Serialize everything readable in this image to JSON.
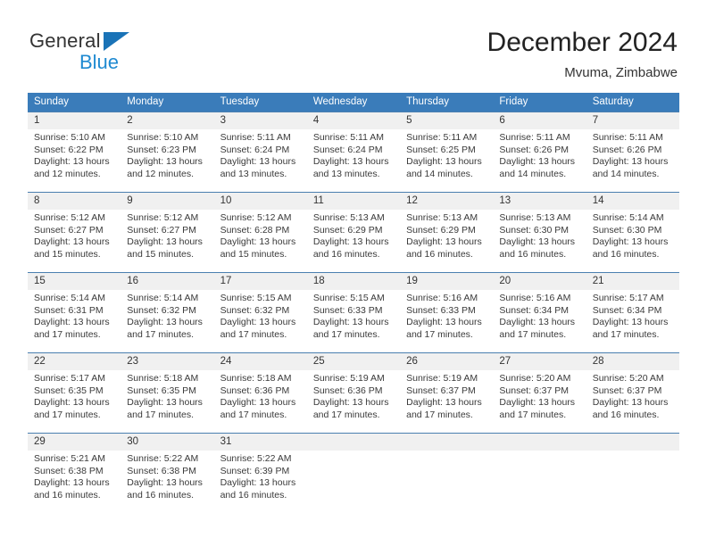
{
  "brand": {
    "name_top": "General",
    "name_bottom": "Blue",
    "triangle_color": "#1a73b7",
    "blue_text_color": "#1f8ad1"
  },
  "header": {
    "title": "December 2024",
    "subtitle": "Mvuma, Zimbabwe"
  },
  "theme": {
    "header_row_bg": "#3a7cba",
    "header_row_text": "#ffffff",
    "daynum_bg": "#f0f0f0",
    "cell_bg": "#ffffff",
    "row_divider": "#4a7fb0"
  },
  "weekdays": [
    "Sunday",
    "Monday",
    "Tuesday",
    "Wednesday",
    "Thursday",
    "Friday",
    "Saturday"
  ],
  "weeks": [
    {
      "days": [
        {
          "num": "1",
          "sunrise": "Sunrise: 5:10 AM",
          "sunset": "Sunset: 6:22 PM",
          "daylight1": "Daylight: 13 hours",
          "daylight2": "and 12 minutes."
        },
        {
          "num": "2",
          "sunrise": "Sunrise: 5:10 AM",
          "sunset": "Sunset: 6:23 PM",
          "daylight1": "Daylight: 13 hours",
          "daylight2": "and 12 minutes."
        },
        {
          "num": "3",
          "sunrise": "Sunrise: 5:11 AM",
          "sunset": "Sunset: 6:24 PM",
          "daylight1": "Daylight: 13 hours",
          "daylight2": "and 13 minutes."
        },
        {
          "num": "4",
          "sunrise": "Sunrise: 5:11 AM",
          "sunset": "Sunset: 6:24 PM",
          "daylight1": "Daylight: 13 hours",
          "daylight2": "and 13 minutes."
        },
        {
          "num": "5",
          "sunrise": "Sunrise: 5:11 AM",
          "sunset": "Sunset: 6:25 PM",
          "daylight1": "Daylight: 13 hours",
          "daylight2": "and 14 minutes."
        },
        {
          "num": "6",
          "sunrise": "Sunrise: 5:11 AM",
          "sunset": "Sunset: 6:26 PM",
          "daylight1": "Daylight: 13 hours",
          "daylight2": "and 14 minutes."
        },
        {
          "num": "7",
          "sunrise": "Sunrise: 5:11 AM",
          "sunset": "Sunset: 6:26 PM",
          "daylight1": "Daylight: 13 hours",
          "daylight2": "and 14 minutes."
        }
      ]
    },
    {
      "days": [
        {
          "num": "8",
          "sunrise": "Sunrise: 5:12 AM",
          "sunset": "Sunset: 6:27 PM",
          "daylight1": "Daylight: 13 hours",
          "daylight2": "and 15 minutes."
        },
        {
          "num": "9",
          "sunrise": "Sunrise: 5:12 AM",
          "sunset": "Sunset: 6:27 PM",
          "daylight1": "Daylight: 13 hours",
          "daylight2": "and 15 minutes."
        },
        {
          "num": "10",
          "sunrise": "Sunrise: 5:12 AM",
          "sunset": "Sunset: 6:28 PM",
          "daylight1": "Daylight: 13 hours",
          "daylight2": "and 15 minutes."
        },
        {
          "num": "11",
          "sunrise": "Sunrise: 5:13 AM",
          "sunset": "Sunset: 6:29 PM",
          "daylight1": "Daylight: 13 hours",
          "daylight2": "and 16 minutes."
        },
        {
          "num": "12",
          "sunrise": "Sunrise: 5:13 AM",
          "sunset": "Sunset: 6:29 PM",
          "daylight1": "Daylight: 13 hours",
          "daylight2": "and 16 minutes."
        },
        {
          "num": "13",
          "sunrise": "Sunrise: 5:13 AM",
          "sunset": "Sunset: 6:30 PM",
          "daylight1": "Daylight: 13 hours",
          "daylight2": "and 16 minutes."
        },
        {
          "num": "14",
          "sunrise": "Sunrise: 5:14 AM",
          "sunset": "Sunset: 6:30 PM",
          "daylight1": "Daylight: 13 hours",
          "daylight2": "and 16 minutes."
        }
      ]
    },
    {
      "days": [
        {
          "num": "15",
          "sunrise": "Sunrise: 5:14 AM",
          "sunset": "Sunset: 6:31 PM",
          "daylight1": "Daylight: 13 hours",
          "daylight2": "and 17 minutes."
        },
        {
          "num": "16",
          "sunrise": "Sunrise: 5:14 AM",
          "sunset": "Sunset: 6:32 PM",
          "daylight1": "Daylight: 13 hours",
          "daylight2": "and 17 minutes."
        },
        {
          "num": "17",
          "sunrise": "Sunrise: 5:15 AM",
          "sunset": "Sunset: 6:32 PM",
          "daylight1": "Daylight: 13 hours",
          "daylight2": "and 17 minutes."
        },
        {
          "num": "18",
          "sunrise": "Sunrise: 5:15 AM",
          "sunset": "Sunset: 6:33 PM",
          "daylight1": "Daylight: 13 hours",
          "daylight2": "and 17 minutes."
        },
        {
          "num": "19",
          "sunrise": "Sunrise: 5:16 AM",
          "sunset": "Sunset: 6:33 PM",
          "daylight1": "Daylight: 13 hours",
          "daylight2": "and 17 minutes."
        },
        {
          "num": "20",
          "sunrise": "Sunrise: 5:16 AM",
          "sunset": "Sunset: 6:34 PM",
          "daylight1": "Daylight: 13 hours",
          "daylight2": "and 17 minutes."
        },
        {
          "num": "21",
          "sunrise": "Sunrise: 5:17 AM",
          "sunset": "Sunset: 6:34 PM",
          "daylight1": "Daylight: 13 hours",
          "daylight2": "and 17 minutes."
        }
      ]
    },
    {
      "days": [
        {
          "num": "22",
          "sunrise": "Sunrise: 5:17 AM",
          "sunset": "Sunset: 6:35 PM",
          "daylight1": "Daylight: 13 hours",
          "daylight2": "and 17 minutes."
        },
        {
          "num": "23",
          "sunrise": "Sunrise: 5:18 AM",
          "sunset": "Sunset: 6:35 PM",
          "daylight1": "Daylight: 13 hours",
          "daylight2": "and 17 minutes."
        },
        {
          "num": "24",
          "sunrise": "Sunrise: 5:18 AM",
          "sunset": "Sunset: 6:36 PM",
          "daylight1": "Daylight: 13 hours",
          "daylight2": "and 17 minutes."
        },
        {
          "num": "25",
          "sunrise": "Sunrise: 5:19 AM",
          "sunset": "Sunset: 6:36 PM",
          "daylight1": "Daylight: 13 hours",
          "daylight2": "and 17 minutes."
        },
        {
          "num": "26",
          "sunrise": "Sunrise: 5:19 AM",
          "sunset": "Sunset: 6:37 PM",
          "daylight1": "Daylight: 13 hours",
          "daylight2": "and 17 minutes."
        },
        {
          "num": "27",
          "sunrise": "Sunrise: 5:20 AM",
          "sunset": "Sunset: 6:37 PM",
          "daylight1": "Daylight: 13 hours",
          "daylight2": "and 17 minutes."
        },
        {
          "num": "28",
          "sunrise": "Sunrise: 5:20 AM",
          "sunset": "Sunset: 6:37 PM",
          "daylight1": "Daylight: 13 hours",
          "daylight2": "and 16 minutes."
        }
      ]
    },
    {
      "days": [
        {
          "num": "29",
          "sunrise": "Sunrise: 5:21 AM",
          "sunset": "Sunset: 6:38 PM",
          "daylight1": "Daylight: 13 hours",
          "daylight2": "and 16 minutes."
        },
        {
          "num": "30",
          "sunrise": "Sunrise: 5:22 AM",
          "sunset": "Sunset: 6:38 PM",
          "daylight1": "Daylight: 13 hours",
          "daylight2": "and 16 minutes."
        },
        {
          "num": "31",
          "sunrise": "Sunrise: 5:22 AM",
          "sunset": "Sunset: 6:39 PM",
          "daylight1": "Daylight: 13 hours",
          "daylight2": "and 16 minutes."
        },
        {
          "num": "",
          "sunrise": "",
          "sunset": "",
          "daylight1": "",
          "daylight2": ""
        },
        {
          "num": "",
          "sunrise": "",
          "sunset": "",
          "daylight1": "",
          "daylight2": ""
        },
        {
          "num": "",
          "sunrise": "",
          "sunset": "",
          "daylight1": "",
          "daylight2": ""
        },
        {
          "num": "",
          "sunrise": "",
          "sunset": "",
          "daylight1": "",
          "daylight2": ""
        }
      ]
    }
  ]
}
